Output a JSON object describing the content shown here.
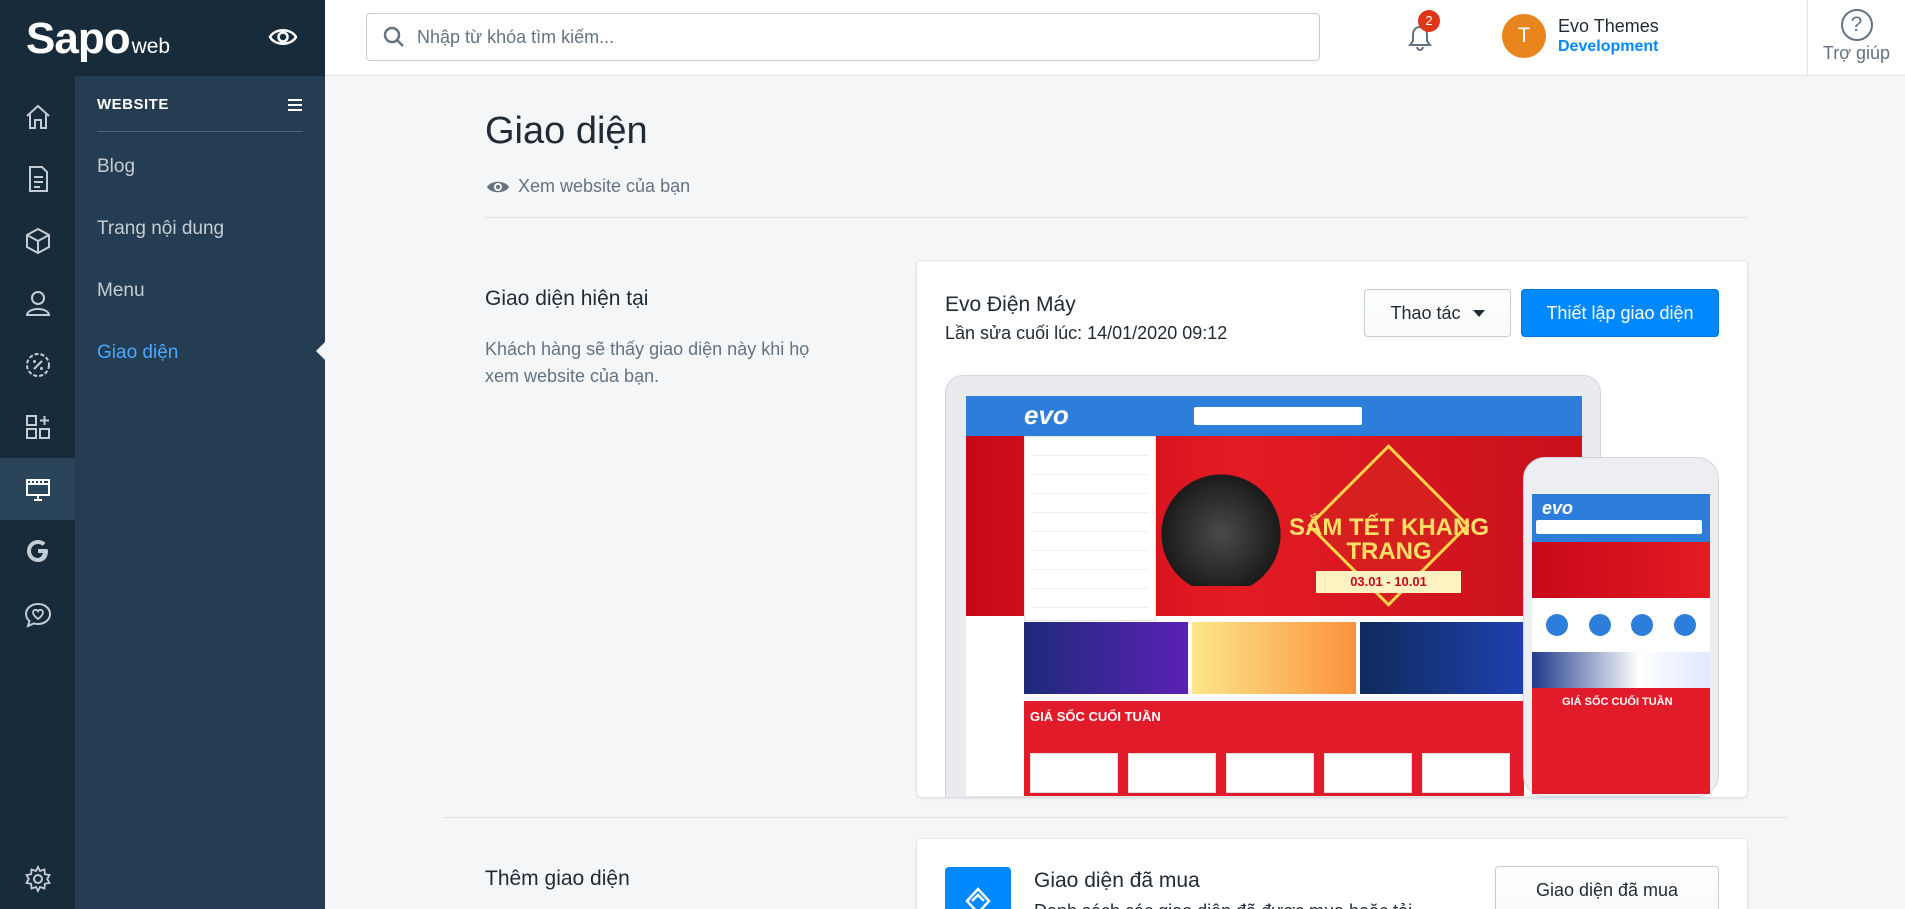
{
  "brand": {
    "logo_main": "Sapo",
    "logo_sub": "web"
  },
  "search": {
    "placeholder": "Nhập từ khóa tìm kiếm..."
  },
  "notifications": {
    "count": "2"
  },
  "user": {
    "initial": "T",
    "name": "Evo Themes",
    "role": "Development"
  },
  "help": {
    "icon": "?",
    "label": "Trợ giúp"
  },
  "rail": {
    "icons": [
      "home-icon",
      "orders-icon",
      "products-icon",
      "customers-icon",
      "discounts-icon",
      "apps-icon",
      "website-icon",
      "google-icon",
      "social-icon",
      "settings-icon"
    ]
  },
  "subnav": {
    "title": "WEBSITE",
    "items": [
      {
        "label": "Blog"
      },
      {
        "label": "Trang nội dung"
      },
      {
        "label": "Menu"
      },
      {
        "label": "Giao diện"
      }
    ],
    "active_index": 3
  },
  "page": {
    "title": "Giao diện",
    "view_site": "Xem website của bạn"
  },
  "current_theme": {
    "section_title": "Giao diện hiện tại",
    "section_desc": "Khách hàng sẽ thấy giao diện này khi họ xem website của bạn.",
    "name": "Evo Điện Máy",
    "last_edited": "Lần sửa cuối lúc: 14/01/2020 09:12",
    "action_button": "Thao tác",
    "setup_button": "Thiết lập giao diện"
  },
  "preview": {
    "site_logo": "evo",
    "banner_text": "SẮM TẾT KHANG TRANG",
    "banner_date": "03.01 - 10.01",
    "sale_label": "GIÁ SỐC CUỐI TUẦN"
  },
  "add_theme": {
    "section_title": "Thêm giao diện",
    "card_title": "Giao diện đã mua",
    "card_desc": "Danh sách các giao diện đã được mua hoặc tải",
    "button": "Giao diện đã mua"
  },
  "colors": {
    "sidebar_dark": "#172b3a",
    "subnav": "#253d52",
    "primary": "#0088ff",
    "active_link": "#47a8ff",
    "badge": "#de3618",
    "avatar": "#e8851c"
  }
}
